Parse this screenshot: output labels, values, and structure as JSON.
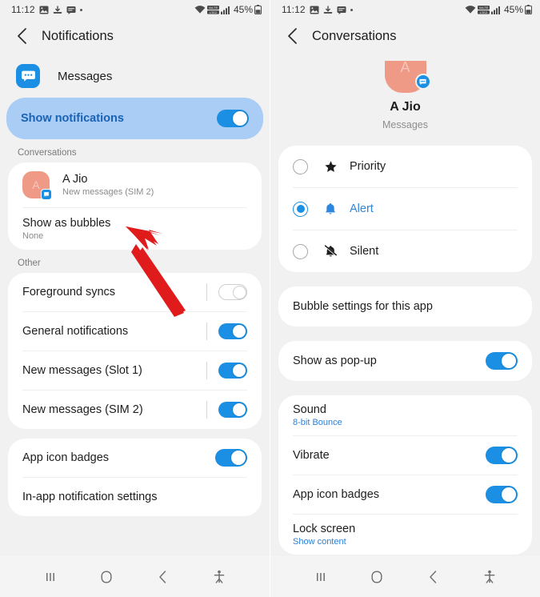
{
  "status_bar": {
    "time": "11:12",
    "battery_percent": "45%",
    "icons": [
      "image-icon",
      "download-icon",
      "message-icon",
      "dot-icon",
      "wifi-icon",
      "volte-icon",
      "signal-icon",
      "battery-icon"
    ]
  },
  "left_screen": {
    "app_bar": {
      "title": "Notifications",
      "back_icon": "chevron-left-icon"
    },
    "app_header": {
      "name": "Messages",
      "icon": "messages-app-icon"
    },
    "show_notifications": {
      "label": "Show notifications",
      "toggle": "on"
    },
    "conversations_section": {
      "header": "Conversations"
    },
    "conversation": {
      "name": "A Jio",
      "subtitle": "New messages (SIM 2)",
      "avatar_letter": "A"
    },
    "show_as_bubbles": {
      "label": "Show as bubbles",
      "value": "None"
    },
    "other_section": {
      "header": "Other"
    },
    "other_rows": [
      {
        "label": "Foreground syncs",
        "toggle": "off"
      },
      {
        "label": "General notifications",
        "toggle": "on"
      },
      {
        "label": "New messages (Slot 1)",
        "toggle": "on"
      },
      {
        "label": "New messages (SIM 2)",
        "toggle": "on"
      }
    ],
    "bottom_rows": [
      {
        "label": "App icon badges",
        "toggle": "on"
      },
      {
        "label": "In-app notification settings",
        "toggle": "none"
      }
    ]
  },
  "right_screen": {
    "app_bar": {
      "title": "Conversations",
      "back_icon": "chevron-left-icon"
    },
    "hero": {
      "name": "A Jio",
      "subtitle": "Messages",
      "avatar_letter": "A"
    },
    "importance_options": [
      {
        "label": "Priority",
        "icon": "star-icon",
        "selected": false
      },
      {
        "label": "Alert",
        "icon": "bell-icon",
        "selected": true
      },
      {
        "label": "Silent",
        "icon": "bell-off-icon",
        "selected": false
      }
    ],
    "bubble_settings": {
      "label": "Bubble settings for this app"
    },
    "show_as_popup": {
      "label": "Show as pop-up",
      "toggle": "on"
    },
    "settings_rows": [
      {
        "label": "Sound",
        "value": "8-bit Bounce",
        "toggle": "none"
      },
      {
        "label": "Vibrate",
        "value": "",
        "toggle": "on"
      },
      {
        "label": "App icon badges",
        "value": "",
        "toggle": "on"
      },
      {
        "label": "Lock screen",
        "value": "Show content",
        "toggle": "none"
      }
    ]
  },
  "nav_bar": {
    "recents_label": "recents-icon",
    "home_label": "home-icon",
    "back_label": "back-icon",
    "accessibility_label": "accessibility-icon"
  },
  "annotation": {
    "arrow_color": "#e01b1b"
  },
  "colors": {
    "accent_blue": "#1a8fe3",
    "highlight_bg": "#a9cdf4",
    "highlight_text": "#1a62b5",
    "page_bg": "#f1f1f1",
    "card_bg": "#ffffff",
    "avatar": "#ef9a86"
  }
}
